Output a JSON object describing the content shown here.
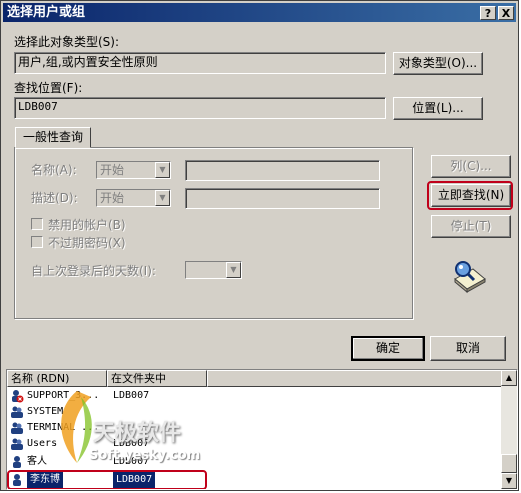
{
  "window": {
    "title": "选择用户或组",
    "help_button": "?",
    "close_button": "X"
  },
  "object_type": {
    "label": "选择此对象类型(S):",
    "value": "用户,组,或内置安全性原则",
    "button": "对象类型(O)..."
  },
  "location": {
    "label": "查找位置(F):",
    "value": "LDB007",
    "button": "位置(L)..."
  },
  "query": {
    "tab": "一般性查询",
    "name_label": "名称(A):",
    "name_mode": "开始",
    "desc_label": "描述(D):",
    "desc_mode": "开始",
    "disabled_accounts": "禁用的帐户(B)",
    "non_expiring": "不过期密码(X)",
    "days_label": "自上次登录后的天数(I):"
  },
  "actions": {
    "columns": "列(C)...",
    "find_now": "立即查找(N)",
    "stop": "停止(T)",
    "ok": "确定",
    "cancel": "取消"
  },
  "results": {
    "columns": [
      "名称 (RDN)",
      "在文件夹中"
    ],
    "rows": [
      {
        "name": "SUPPORT_3...",
        "folder": "LDB007"
      },
      {
        "name": "SYSTEM",
        "folder": ""
      },
      {
        "name": "TERMINAL ...",
        "folder": ""
      },
      {
        "name": "Users",
        "folder": "LDB007"
      },
      {
        "name": "客人",
        "folder": "LDB007"
      },
      {
        "name": "李东博",
        "folder": "LDB007"
      }
    ]
  },
  "watermark": {
    "brand": "天极软件",
    "site": "Soft.yesky.com"
  },
  "colors": {
    "titlebar": "#0a246a",
    "highlight_ring": "#c0001a",
    "selection": "#0a246a"
  }
}
